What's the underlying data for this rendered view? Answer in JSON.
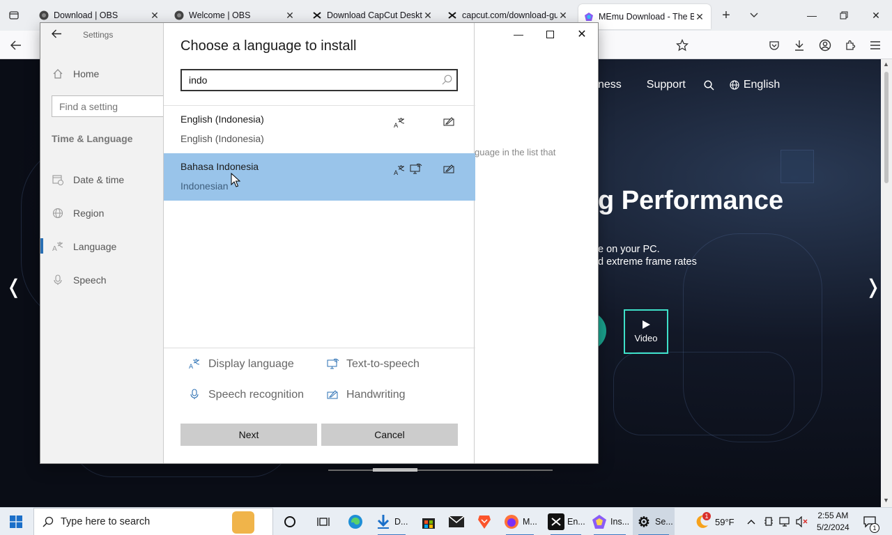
{
  "browser": {
    "tabs": [
      {
        "title": "Download | OBS"
      },
      {
        "title": "Welcome | OBS"
      },
      {
        "title": "Download CapCut Deskto"
      },
      {
        "title": "capcut.com/download-gu"
      },
      {
        "title": "MEmu Download - The Be"
      }
    ]
  },
  "website": {
    "nav": {
      "item_partial": "ness",
      "support": "Support",
      "language": "English"
    },
    "hero_title_partial": "g Performance",
    "hero_line1_partial": "e on your PC.",
    "hero_line2_partial": "d extreme frame rates",
    "teal_button_partial": "d",
    "video_button": "Video"
  },
  "settings": {
    "window_title": "Settings",
    "sidebar": {
      "home": "Home",
      "search_placeholder": "Find a setting",
      "section": "Time & Language",
      "items": [
        {
          "label": "Date & time"
        },
        {
          "label": "Region"
        },
        {
          "label": "Language"
        },
        {
          "label": "Speech"
        }
      ]
    },
    "background_text_partial": "guage in the list that"
  },
  "dialog": {
    "title": "Choose a language to install",
    "search_value": "indo",
    "languages": [
      {
        "name": "English (Indonesia)",
        "native": "English (Indonesia)",
        "features": [
          "display-language",
          "handwriting"
        ]
      },
      {
        "name": "Bahasa Indonesia",
        "native": "Indonesian",
        "features": [
          "display-language",
          "text-to-speech",
          "handwriting"
        ]
      }
    ],
    "legend": {
      "display_language": "Display language",
      "text_to_speech": "Text-to-speech",
      "speech_recognition": "Speech recognition",
      "handwriting": "Handwriting"
    },
    "next_button": "Next",
    "cancel_button": "Cancel"
  },
  "taskbar": {
    "search_placeholder": "Type here to search",
    "apps": [
      {
        "label": "D..."
      },
      {
        "label": "M..."
      },
      {
        "label": "En..."
      },
      {
        "label": "Ins..."
      },
      {
        "label": "Se..."
      }
    ],
    "weather": "59°F",
    "weather_badge": "1",
    "time": "2:55 AM",
    "date": "5/2/2024",
    "notification_count": "1"
  },
  "colors": {
    "selected_row": "#99c4ea",
    "accent_blue": "#2a6fb3",
    "video_border": "#3ee0c8"
  }
}
